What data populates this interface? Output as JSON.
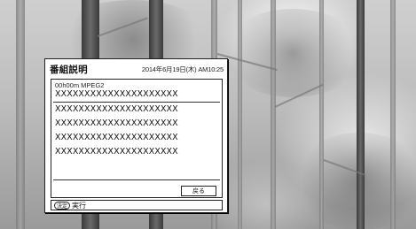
{
  "dialog": {
    "title": "番組説明",
    "datetime": "2014年6月19日(木) AM10:25",
    "program_info": "00h00m MPEG2",
    "description_lines": [
      "XXXXXXXXXXXXXXXXXXXXX",
      "XXXXXXXXXXXXXXXXXXXXX",
      "XXXXXXXXXXXXXXXXXXXXX",
      "XXXXXXXXXXXXXXXXXXXXX",
      "XXXXXXXXXXXXXXXXXXXXX"
    ],
    "back_button": "戻る",
    "footer": {
      "key_icon": "決定",
      "action": "実行"
    }
  }
}
